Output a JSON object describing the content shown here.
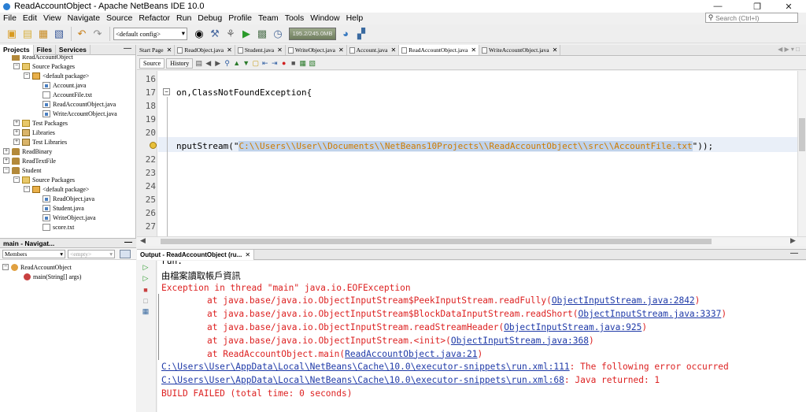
{
  "window": {
    "title": "ReadAccountObject - Apache NetBeans IDE 10.0",
    "controls": [
      "—",
      "❐",
      "✕"
    ]
  },
  "menu": [
    "File",
    "Edit",
    "View",
    "Navigate",
    "Source",
    "Refactor",
    "Run",
    "Debug",
    "Profile",
    "Team",
    "Tools",
    "Window",
    "Help"
  ],
  "search": {
    "placeholder": "Search (Ctrl+I)"
  },
  "toolbar": {
    "config": "<default config>",
    "memory": "195.2/245.0MB"
  },
  "projects_panel": {
    "tabs": [
      "Projects",
      "Files",
      "Services"
    ],
    "tree": [
      {
        "label": "ReadAccountObject",
        "depth": 0,
        "icon": "project",
        "toggle": ""
      },
      {
        "label": "Source Packages",
        "depth": 1,
        "icon": "folder",
        "toggle": "−"
      },
      {
        "label": "<default package>",
        "depth": 2,
        "icon": "package",
        "toggle": "−"
      },
      {
        "label": "Account.java",
        "depth": 3,
        "icon": "java",
        "toggle": ""
      },
      {
        "label": "AccountFile.txt",
        "depth": 3,
        "icon": "txt",
        "toggle": ""
      },
      {
        "label": "ReadAccountObject.java",
        "depth": 3,
        "icon": "java",
        "toggle": ""
      },
      {
        "label": "WriteAccountObject.java",
        "depth": 3,
        "icon": "java",
        "toggle": ""
      },
      {
        "label": "Test Packages",
        "depth": 1,
        "icon": "folder",
        "toggle": "+"
      },
      {
        "label": "Libraries",
        "depth": 1,
        "icon": "library",
        "toggle": "+"
      },
      {
        "label": "Test Libraries",
        "depth": 1,
        "icon": "library",
        "toggle": "+"
      },
      {
        "label": "ReadBinary",
        "depth": 0,
        "icon": "project",
        "toggle": "+"
      },
      {
        "label": "ReadTextFile",
        "depth": 0,
        "icon": "project",
        "toggle": "+"
      },
      {
        "label": "Student",
        "depth": 0,
        "icon": "project",
        "toggle": "−"
      },
      {
        "label": "Source Packages",
        "depth": 1,
        "icon": "folder",
        "toggle": "−"
      },
      {
        "label": "<default package>",
        "depth": 2,
        "icon": "package",
        "toggle": "−"
      },
      {
        "label": "ReadObject.java",
        "depth": 3,
        "icon": "java",
        "toggle": ""
      },
      {
        "label": "Student.java",
        "depth": 3,
        "icon": "java",
        "toggle": ""
      },
      {
        "label": "WriteObject.java",
        "depth": 3,
        "icon": "java",
        "toggle": ""
      },
      {
        "label": "score.txt",
        "depth": 3,
        "icon": "txt",
        "toggle": ""
      }
    ]
  },
  "navigator": {
    "title": "main - Navigat...",
    "filter_label": "Members",
    "filter_value": "<empty>",
    "items": [
      {
        "label": "ReadAccountObject",
        "depth": 0
      },
      {
        "label": "main(String[] args)",
        "depth": 1
      }
    ]
  },
  "editor_tabs": [
    {
      "label": "Start Page",
      "active": false
    },
    {
      "label": "ReadObject.java",
      "active": false
    },
    {
      "label": "Student.java",
      "active": false
    },
    {
      "label": "WriteObject.java",
      "active": false
    },
    {
      "label": "Account.java",
      "active": false
    },
    {
      "label": "ReadAccountObject.java",
      "active": true
    },
    {
      "label": "WriteAccountObject.java",
      "active": false
    }
  ],
  "editor_toolbar": {
    "source": "Source",
    "history": "History"
  },
  "editor": {
    "lines": [
      {
        "num": "16",
        "pre": "",
        "str": "",
        "post": ""
      },
      {
        "num": "17",
        "pre": "on,ClassNotFoundException{",
        "str": "",
        "post": ""
      },
      {
        "num": "18",
        "pre": "",
        "str": "",
        "post": ""
      },
      {
        "num": "19",
        "pre": "",
        "str": "",
        "post": ""
      },
      {
        "num": "20",
        "pre": "",
        "str": "",
        "post": ""
      },
      {
        "num": "",
        "pre": "nputStream(\"",
        "str": "C:\\\\Users\\\\User\\\\Documents\\\\NetBeans10Projects\\\\ReadAccountObject\\\\src\\\\AccountFile.txt",
        "post": "\"));"
      },
      {
        "num": "22",
        "pre": "",
        "str": "",
        "post": ""
      },
      {
        "num": "23",
        "pre": "",
        "str": "",
        "post": ""
      },
      {
        "num": "24",
        "pre": "",
        "str": "",
        "post": ""
      },
      {
        "num": "25",
        "pre": "",
        "str": "",
        "post": ""
      },
      {
        "num": "26",
        "pre": "",
        "str": "",
        "post": ""
      },
      {
        "num": "27",
        "pre": "",
        "str": "",
        "post": ""
      }
    ]
  },
  "output": {
    "tab": "Output - ReadAccountObject (ru...",
    "lines": [
      {
        "text": "run:",
        "kind": "plain",
        "indent": false
      },
      {
        "text": "由檔案讀取帳戶資訊",
        "kind": "plain",
        "indent": false
      },
      {
        "text": "Exception in thread \"main\" java.io.EOFException",
        "kind": "err",
        "indent": false
      },
      {
        "text": "at java.base/java.io.ObjectInputStream$PeekInputStream.readFully(",
        "link": "ObjectInputStream.java:2842",
        "tail": ")",
        "kind": "err",
        "indent": true
      },
      {
        "text": "at java.base/java.io.ObjectInputStream$BlockDataInputStream.readShort(",
        "link": "ObjectInputStream.java:3337",
        "tail": ")",
        "kind": "err",
        "indent": true
      },
      {
        "text": "at java.base/java.io.ObjectInputStream.readStreamHeader(",
        "link": "ObjectInputStream.java:925",
        "tail": ")",
        "kind": "err",
        "indent": true
      },
      {
        "text": "at java.base/java.io.ObjectInputStream.<init>(",
        "link": "ObjectInputStream.java:368",
        "tail": ")",
        "kind": "err",
        "indent": true
      },
      {
        "text": "at ReadAccountObject.main(",
        "link": "ReadAccountObject.java:21",
        "tail": ")",
        "kind": "err",
        "indent": true
      },
      {
        "text": "",
        "link": "C:\\Users\\User\\AppData\\Local\\NetBeans\\Cache\\10.0\\executor-snippets\\run.xml:111",
        "tail": ": The following error occurred",
        "kind": "err",
        "indent": false
      },
      {
        "text": "",
        "link": "C:\\Users\\User\\AppData\\Local\\NetBeans\\Cache\\10.0\\executor-snippets\\run.xml:68",
        "tail": ": Java returned: 1",
        "kind": "err",
        "indent": false
      },
      {
        "text": "BUILD FAILED (total time: 0 seconds)",
        "kind": "err",
        "indent": false
      }
    ]
  }
}
